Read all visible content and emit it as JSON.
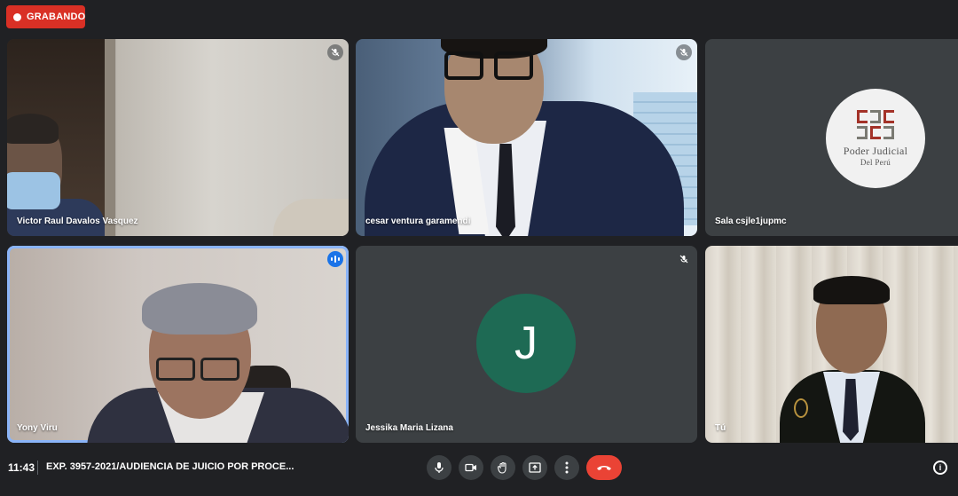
{
  "recording": {
    "label": "GRABANDO",
    "color": "#d93025"
  },
  "participants": [
    {
      "name": "Victor Raul Davalos Vasquez",
      "muted": true
    },
    {
      "name": "cesar ventura garamendi",
      "muted": true
    },
    {
      "name": "Sala csjle1jupmc",
      "muted": false,
      "logo_line1": "Poder Judicial",
      "logo_line2": "Del Perú"
    },
    {
      "name": "Yony Viru",
      "speaking": true
    },
    {
      "name": "Jessika Maria Lizana",
      "muted": true,
      "initial": "J",
      "avatar_color": "#1e6a54"
    },
    {
      "name": "Tú"
    }
  ],
  "footer": {
    "time": "11:43",
    "meeting_title": "EXP. 3957-2021/AUDIENCIA DE JUICIO POR PROCE..."
  },
  "controls": [
    {
      "icon": "microphone-icon"
    },
    {
      "icon": "camera-icon"
    },
    {
      "icon": "raise-hand-icon"
    },
    {
      "icon": "present-screen-icon"
    },
    {
      "icon": "more-options-icon"
    },
    {
      "icon": "end-call-icon",
      "color": "#ea4335"
    }
  ],
  "colors": {
    "background": "#202124",
    "tile": "#3c4043",
    "active_outline": "#8ab4f8"
  }
}
